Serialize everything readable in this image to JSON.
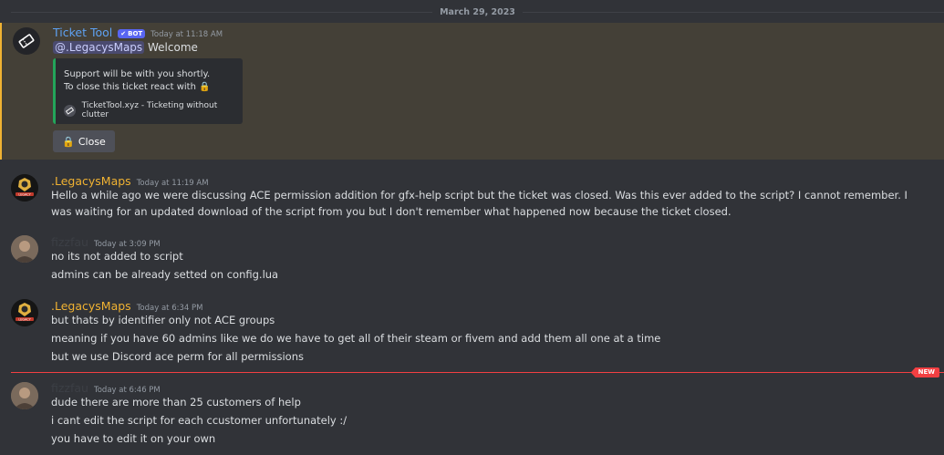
{
  "date_divider": "March 29, 2023",
  "colors": {
    "bot_name": "#5ea1f2",
    "legacy_name": "#f0b232",
    "fizz_name": "#3c3f45",
    "new": "#f23f42"
  },
  "messages": [
    {
      "author": "Ticket Tool",
      "bot_badge": "BOT",
      "timestamp": "Today at 11:18 AM",
      "mention": "@.LegacysMaps",
      "text": "Welcome",
      "embed": {
        "line1": "Support will be with you shortly.",
        "line2": "To close this ticket react with",
        "footer": "TicketTool.xyz - Ticketing without clutter"
      },
      "button": "Close"
    },
    {
      "author": ".LegacysMaps",
      "timestamp": "Today at 11:19 AM",
      "lines": [
        "Hello a while ago we were discussing ACE permission addition for gfx-help script but the ticket was closed. Was this ever added to the script? I cannot remember. I was waiting for an updated download of the script from you but I don't remember what happened now because the ticket closed."
      ]
    },
    {
      "author": "fizzfau",
      "timestamp": "Today at 3:09 PM",
      "lines": [
        "no its not added to script",
        "admins can be already setted on config.lua"
      ]
    },
    {
      "author": ".LegacysMaps",
      "timestamp": "Today at 6:34 PM",
      "lines": [
        "but thats by identifier only not ACE groups",
        "meaning if you have 60 admins like we do we have to get all of their steam or fivem and add them all one at a time",
        "but we use Discord ace perm for all permissions"
      ]
    },
    {
      "author": "fizzfau",
      "timestamp": "Today at 6:46 PM",
      "lines": [
        "dude there are more than 25 customers of help",
        "i cant edit the script for each ccustomer unfortunately :/",
        "you have to edit it on your own"
      ]
    }
  ],
  "new_badge": "NEW"
}
